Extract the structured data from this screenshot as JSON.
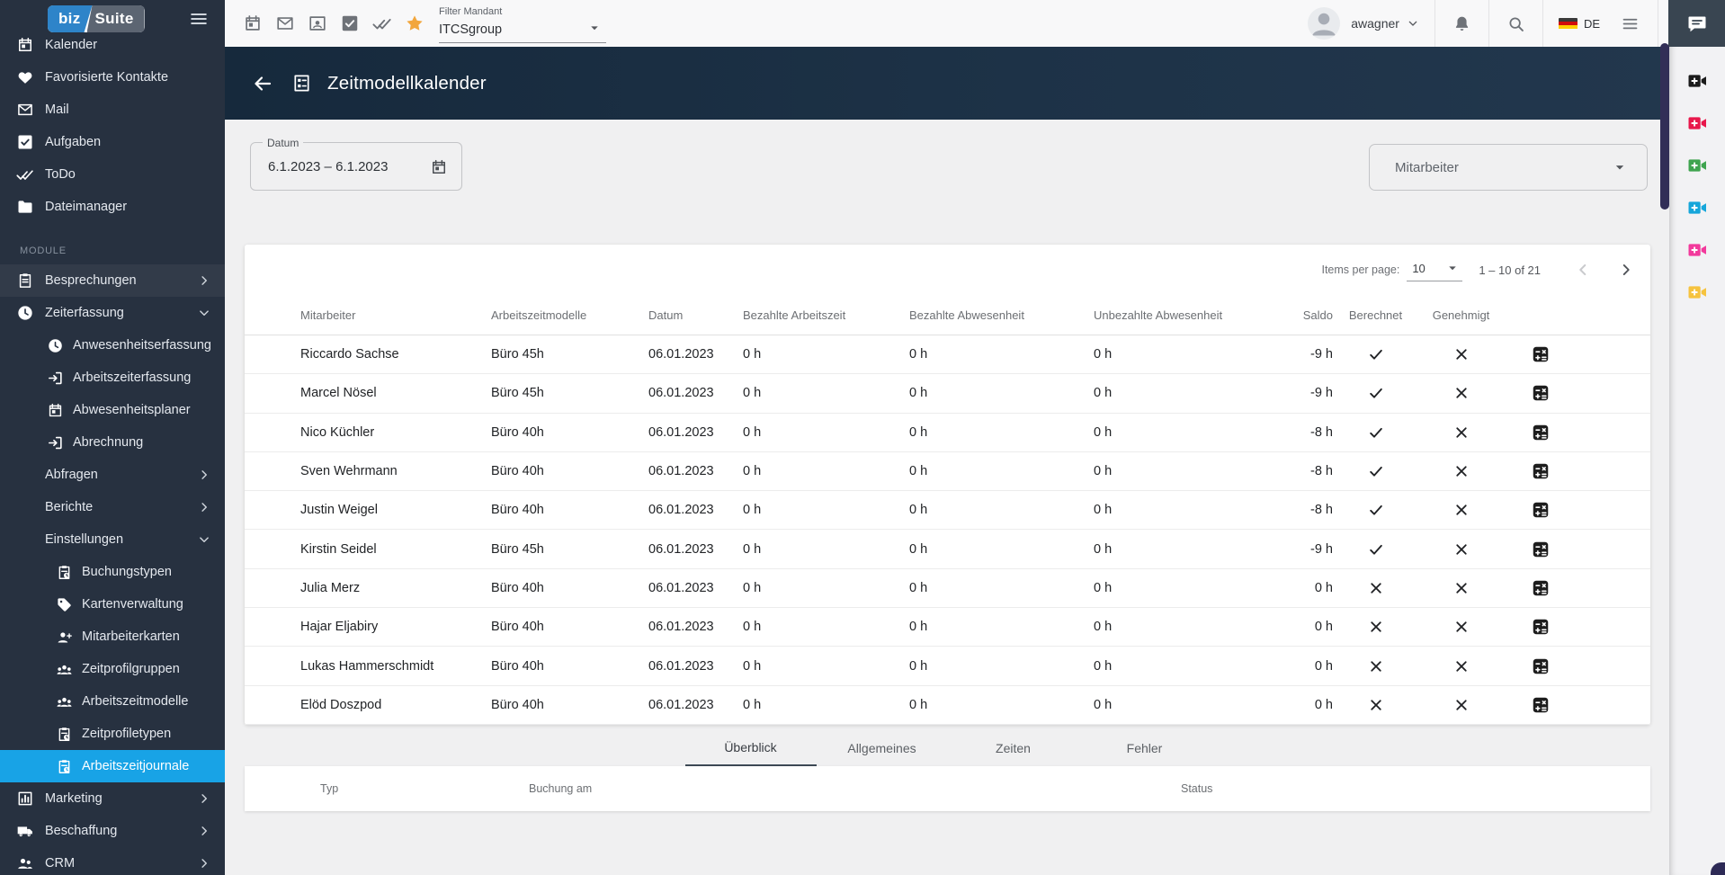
{
  "app": {
    "logo": {
      "part1": "biz",
      "part2": "Suite"
    },
    "colors": {
      "accent_blue": "#18a3e6",
      "logo_blue": "#2e84c9",
      "logo_gray": "#5c6572",
      "header_navy": "#1d3247",
      "sidebar_bg": "#273140",
      "star_yellow": "#f2a63c",
      "scrollbar_purple": "#322e57"
    }
  },
  "toolbar": {
    "icons": [
      {
        "name": "calendar-icon",
        "glyph": "calendar"
      },
      {
        "name": "mail-icon",
        "glyph": "mail"
      },
      {
        "name": "contact-card-icon",
        "glyph": "contact"
      },
      {
        "name": "tasks-icon",
        "glyph": "task"
      },
      {
        "name": "done-all-icon",
        "glyph": "done-all"
      },
      {
        "name": "favorites-star-icon",
        "glyph": "star"
      }
    ],
    "filter": {
      "label": "Filter Mandant",
      "value": "ITCSgroup"
    },
    "user": {
      "name": "awagner"
    },
    "language": "DE"
  },
  "page_header": {
    "title": "Zeitmodellkalender"
  },
  "filters": {
    "date": {
      "label": "Datum",
      "value": "6.1.2023 – 6.1.2023"
    },
    "employee": {
      "label": "Mitarbeiter"
    }
  },
  "sidebar": {
    "items": [
      {
        "glyph": "calendar",
        "label": "Kalender",
        "level": 0
      },
      {
        "glyph": "heart",
        "label": "Favorisierte Kontakte",
        "level": 0
      },
      {
        "glyph": "mail",
        "label": "Mail",
        "level": 0
      },
      {
        "glyph": "task",
        "label": "Aufgaben",
        "level": 0
      },
      {
        "glyph": "done-all",
        "label": "ToDo",
        "level": 0
      },
      {
        "glyph": "folder",
        "label": "Dateimanager",
        "level": 0
      },
      {
        "section": true,
        "label": "MODULE"
      },
      {
        "glyph": "clipboard",
        "label": "Besprechungen",
        "level": 0,
        "chevron": "right",
        "hover": true
      },
      {
        "glyph": "clock",
        "label": "Zeiterfassung",
        "level": 0,
        "chevron": "down"
      },
      {
        "glyph": "clock",
        "label": "Anwesenheitserfassung",
        "level": 1
      },
      {
        "glyph": "login",
        "label": "Arbeitszeiterfassung",
        "level": 1
      },
      {
        "glyph": "calendar",
        "label": "Abwesenheitsplaner",
        "level": 1
      },
      {
        "glyph": "login",
        "label": "Abrechnung",
        "level": 1
      },
      {
        "glyph": null,
        "label": "Abfragen",
        "level": 0,
        "chevron": "right"
      },
      {
        "glyph": null,
        "label": "Berichte",
        "level": 0,
        "chevron": "right"
      },
      {
        "glyph": null,
        "label": "Einstellungen",
        "level": 0,
        "chevron": "down"
      },
      {
        "glyph": "clipboard-clock",
        "label": "Buchungstypen",
        "level": 2
      },
      {
        "glyph": "tag",
        "label": "Kartenverwaltung",
        "level": 2
      },
      {
        "glyph": "person-add",
        "label": "Mitarbeiterkarten",
        "level": 2
      },
      {
        "glyph": "groups",
        "label": "Zeitprofilgruppen",
        "level": 2
      },
      {
        "glyph": "groups",
        "label": "Arbeitszeitmodelle",
        "level": 2
      },
      {
        "glyph": "clipboard-clock",
        "label": "Zeitprofiletypen",
        "level": 2
      },
      {
        "glyph": "clipboard-clock",
        "label": "Arbeitszeitjournale",
        "level": 2,
        "active": true
      },
      {
        "glyph": "chart",
        "label": "Marketing",
        "level": 0,
        "chevron": "right"
      },
      {
        "glyph": "truck",
        "label": "Beschaffung",
        "level": 0,
        "chevron": "right"
      },
      {
        "glyph": "people",
        "label": "CRM",
        "level": 0,
        "chevron": "right"
      }
    ]
  },
  "paginator": {
    "items_per_page_label": "Items per page:",
    "items_per_page_value": "10",
    "range_label": "1 – 10 of 21"
  },
  "table": {
    "columns": [
      "Mitarbeiter",
      "Arbeitszeitmodelle",
      "Datum",
      "Bezahlte Arbeitszeit",
      "Bezahlte Abwesenheit",
      "Unbezahlte Abwesenheit",
      "Saldo",
      "Berechnet",
      "Genehmigt",
      ""
    ],
    "rows": [
      {
        "mitarbeiter": "Riccardo Sachse",
        "modell": "Büro 45h",
        "datum": "06.01.2023",
        "bez_zeit": "0 h",
        "bez_abw": "0 h",
        "unbez_abw": "0 h",
        "saldo": "-9 h",
        "berechnet": true,
        "genehmigt": false
      },
      {
        "mitarbeiter": "Marcel Nösel",
        "modell": "Büro 45h",
        "datum": "06.01.2023",
        "bez_zeit": "0 h",
        "bez_abw": "0 h",
        "unbez_abw": "0 h",
        "saldo": "-9 h",
        "berechnet": true,
        "genehmigt": false
      },
      {
        "mitarbeiter": "Nico Küchler",
        "modell": "Büro 40h",
        "datum": "06.01.2023",
        "bez_zeit": "0 h",
        "bez_abw": "0 h",
        "unbez_abw": "0 h",
        "saldo": "-8 h",
        "berechnet": true,
        "genehmigt": false
      },
      {
        "mitarbeiter": "Sven Wehrmann",
        "modell": "Büro 40h",
        "datum": "06.01.2023",
        "bez_zeit": "0 h",
        "bez_abw": "0 h",
        "unbez_abw": "0 h",
        "saldo": "-8 h",
        "berechnet": true,
        "genehmigt": false
      },
      {
        "mitarbeiter": "Justin Weigel",
        "modell": "Büro 40h",
        "datum": "06.01.2023",
        "bez_zeit": "0 h",
        "bez_abw": "0 h",
        "unbez_abw": "0 h",
        "saldo": "-8 h",
        "berechnet": true,
        "genehmigt": false
      },
      {
        "mitarbeiter": "Kirstin Seidel",
        "modell": "Büro 45h",
        "datum": "06.01.2023",
        "bez_zeit": "0 h",
        "bez_abw": "0 h",
        "unbez_abw": "0 h",
        "saldo": "-9 h",
        "berechnet": true,
        "genehmigt": false
      },
      {
        "mitarbeiter": "Julia Merz",
        "modell": "Büro 40h",
        "datum": "06.01.2023",
        "bez_zeit": "0 h",
        "bez_abw": "0 h",
        "unbez_abw": "0 h",
        "saldo": "0 h",
        "berechnet": false,
        "genehmigt": false
      },
      {
        "mitarbeiter": "Hajar Eljabiry",
        "modell": "Büro 40h",
        "datum": "06.01.2023",
        "bez_zeit": "0 h",
        "bez_abw": "0 h",
        "unbez_abw": "0 h",
        "saldo": "0 h",
        "berechnet": false,
        "genehmigt": false
      },
      {
        "mitarbeiter": "Lukas Hammerschmidt",
        "modell": "Büro 40h",
        "datum": "06.01.2023",
        "bez_zeit": "0 h",
        "bez_abw": "0 h",
        "unbez_abw": "0 h",
        "saldo": "0 h",
        "berechnet": false,
        "genehmigt": false
      },
      {
        "mitarbeiter": "Elöd Doszpod",
        "modell": "Büro 40h",
        "datum": "06.01.2023",
        "bez_zeit": "0 h",
        "bez_abw": "0 h",
        "unbez_abw": "0 h",
        "saldo": "0 h",
        "berechnet": false,
        "genehmigt": false
      }
    ]
  },
  "tabs": [
    {
      "label": "Überblick",
      "active": true
    },
    {
      "label": "Allgemeines",
      "active": false
    },
    {
      "label": "Zeiten",
      "active": false
    },
    {
      "label": "Fehler",
      "active": false
    }
  ],
  "detail_table": {
    "columns": [
      "Typ",
      "Buchung am",
      "Status"
    ]
  },
  "video_strip": {
    "icons": [
      {
        "name": "video-call-icon",
        "color": "#1b1b1b"
      },
      {
        "name": "video-call-icon",
        "color": "#e8174b"
      },
      {
        "name": "video-call-icon",
        "color": "#3fa44f"
      },
      {
        "name": "video-call-icon",
        "color": "#16a6da"
      },
      {
        "name": "video-call-icon",
        "color": "#f23a9c"
      },
      {
        "name": "video-call-icon",
        "color": "#f6c33e"
      }
    ]
  }
}
